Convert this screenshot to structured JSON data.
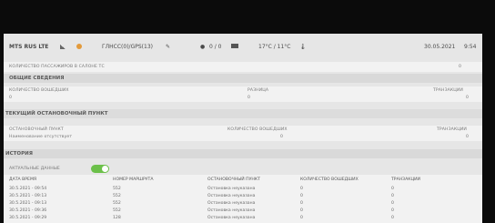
{
  "statusbar": {
    "operator": "MTS RUS LTE",
    "gnss": "ГЛНСС(0)/GPS(13)",
    "counter": "0 / 0",
    "temperature": "17°C / 11°C",
    "date": "30.05.2021",
    "time": "9:54"
  },
  "passengers_in_cabin": {
    "label": "КОЛИЧЕСТВО ПАССАЖИРОВ В САЛОНЕ ТС",
    "value": "0"
  },
  "general": {
    "title": "ОБЩИЕ СВЕДЕНИЯ",
    "columns": [
      "КОЛИЧЕСТВО ВОШЕДШИХ",
      "РАЗНИЦА",
      "ТРАНЗАКЦИИ"
    ],
    "values": [
      "0",
      "0",
      "0"
    ]
  },
  "current_stop": {
    "title": "ТЕКУЩИЙ ОСТАНОВОЧНЫЙ ПУНКТ",
    "columns": [
      "ОСТАНОВОЧНЫЙ ПУНКТ",
      "КОЛИЧЕСТВО ВОШЕДШИХ",
      "ТРАНЗАКЦИИ"
    ],
    "values": [
      "Наименование отсутствует",
      "0",
      "0"
    ]
  },
  "history": {
    "title": "ИСТОРИЯ",
    "actual_label": "АКТУАЛЬНЫЕ ДАННЫЕ",
    "columns": [
      "ДАТА ВРЕМЯ",
      "НОМЕР МАРШРУТА",
      "ОСТАНОВОЧНЫЙ ПУНКТ",
      "КОЛИЧЕСТВО ВОШЕДШИХ",
      "ТРАНЗАКЦИИ"
    ],
    "rows": [
      [
        "30.5.2021 - 09:54",
        "552",
        "Остановка неуказана",
        "0",
        "0"
      ],
      [
        "30.5.2021 - 09:13",
        "552",
        "Остановка неуказана",
        "0",
        "0"
      ],
      [
        "30.5.2021 - 09:13",
        "552",
        "Остановка неуказана",
        "0",
        "0"
      ],
      [
        "30.5.2021 - 09:36",
        "552",
        "Остановка неуказана",
        "0",
        "0"
      ],
      [
        "30.5.2021 - 09:29",
        "128",
        "Остановка неуказана",
        "0",
        "0"
      ]
    ]
  }
}
